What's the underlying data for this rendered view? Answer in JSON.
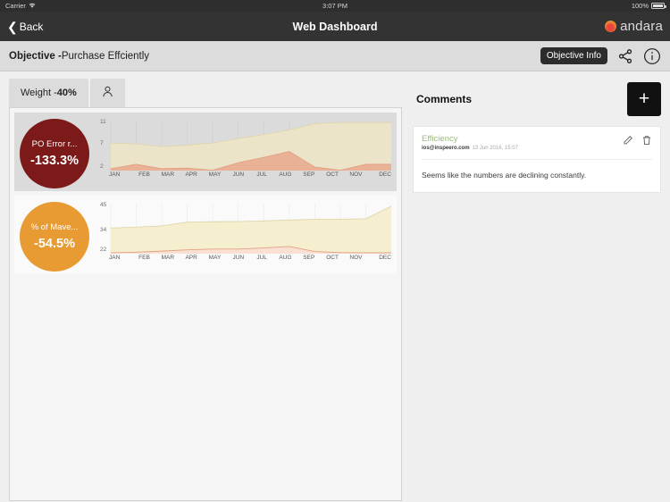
{
  "statusbar": {
    "carrier": "Carrier",
    "time": "3:07 PM",
    "battery": "100%"
  },
  "navbar": {
    "back": "Back",
    "title": "Web Dashboard",
    "brand": "andara"
  },
  "objective": {
    "label": "Objective -",
    "name": "Purchase Effciently",
    "tooltip": "Objective Info"
  },
  "tabs": {
    "weight_label": "Weight -",
    "weight_value": "40%"
  },
  "comments": {
    "heading": "Comments",
    "add_label": "+",
    "items": [
      {
        "subject": "Efficiency",
        "author": "ios@inspeero.com",
        "timestamp": "13 Jun 2016, 15:07",
        "body": "Seems like the numbers are declining constantly."
      }
    ]
  },
  "chart_data": [
    {
      "type": "area",
      "title": "PO Error r...",
      "value": "-133.3%",
      "accent": "#7c1919",
      "categories": [
        "JAN",
        "FEB",
        "MAR",
        "APR",
        "MAY",
        "JUN",
        "JUL",
        "AUG",
        "SEP",
        "OCT",
        "NOV",
        "DEC"
      ],
      "yticks": [
        11,
        7,
        2
      ],
      "ylim": [
        2,
        11
      ],
      "grid": true,
      "legend": "none",
      "xlabel": "",
      "ylabel": "",
      "series": [
        {
          "name": "upper",
          "color": "#ece4c8",
          "values": [
            7.0,
            6.8,
            6.3,
            6.6,
            7.0,
            7.8,
            8.6,
            9.4,
            10.6,
            10.8,
            10.8,
            10.8
          ]
        },
        {
          "name": "lower",
          "color": "#e9b296",
          "values": [
            2.2,
            3.0,
            2.2,
            2.3,
            1.9,
            3.3,
            4.3,
            5.4,
            2.5,
            1.9,
            3.0,
            3.0
          ]
        }
      ]
    },
    {
      "type": "area",
      "title": "% of Mave...",
      "value": "-54.5%",
      "accent": "#e89a33",
      "categories": [
        "JAN",
        "FEB",
        "MAR",
        "APR",
        "MAY",
        "JUN",
        "JUL",
        "AUG",
        "SEP",
        "OCT",
        "NOV",
        "DEC"
      ],
      "yticks": [
        45,
        34,
        22
      ],
      "ylim": [
        22,
        45
      ],
      "grid": true,
      "legend": "none",
      "xlabel": "",
      "ylabel": "",
      "series": [
        {
          "name": "upper",
          "color": "#f5efd0",
          "values": [
            33.8,
            34.2,
            34.8,
            36.6,
            36.8,
            36.9,
            37.2,
            37.6,
            38.0,
            38.0,
            38.2,
            44.2
          ]
        },
        {
          "name": "lower",
          "color": "#fae0d2",
          "values": [
            22.0,
            22.3,
            22.8,
            23.4,
            23.8,
            23.8,
            24.3,
            25.0,
            22.6,
            22.1,
            22.0,
            22.0
          ]
        }
      ]
    }
  ],
  "icons": {
    "back": "chevron-left-icon",
    "share": "share-icon",
    "info": "info-circle-icon",
    "person": "person-icon",
    "edit": "pencil-icon",
    "delete": "trash-icon",
    "wifi": "wifi-icon",
    "battery": "battery-icon"
  }
}
